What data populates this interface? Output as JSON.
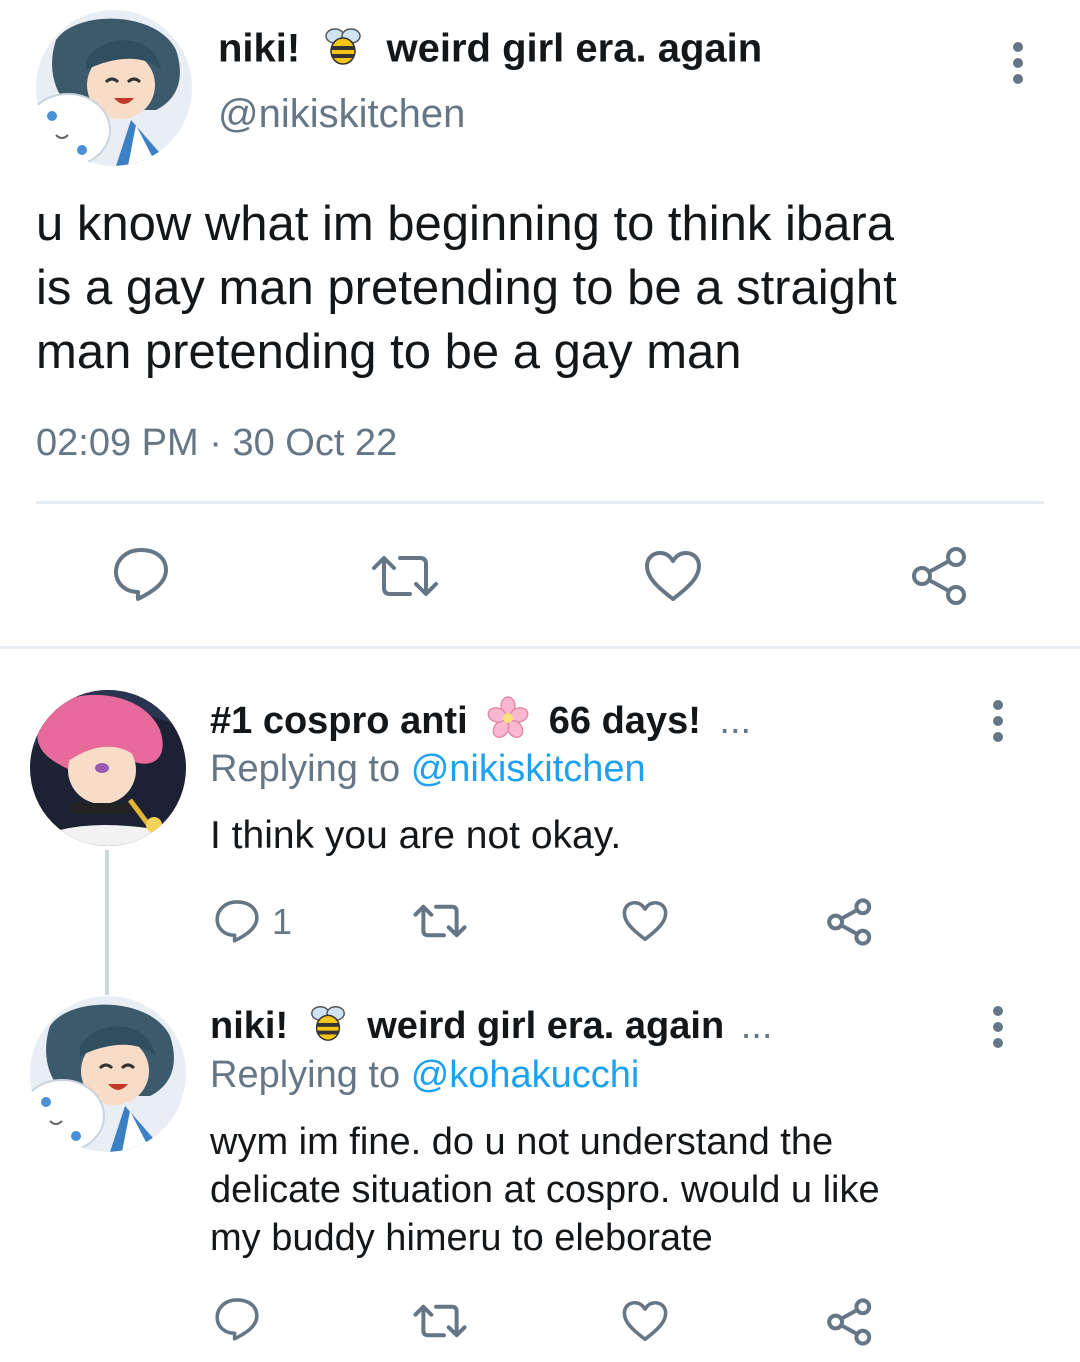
{
  "main_tweet": {
    "display_name": "niki!",
    "name_suffix": "weird girl era. again",
    "name_emoji": "bee-emoji",
    "handle": "@nikiskitchen",
    "text_lines": [
      "u know what im beginning to think ibara",
      "is a gay man pretending to be a straight",
      "man pretending to be a gay man"
    ],
    "time": "02:09 PM",
    "separator": "·",
    "date": "30 Oct 22"
  },
  "reply1": {
    "name_prefix": "#1 cospro anti",
    "name_emoji": "cherry-blossom-emoji",
    "name_suffix": "66 days!",
    "ellipsis": "...",
    "replying_label": "Replying to",
    "replying_handle": "@nikiskitchen",
    "text": "I think you are not okay.",
    "reply_count": "1"
  },
  "reply2": {
    "display_name": "niki!",
    "name_emoji": "bee-emoji",
    "name_suffix": "weird girl era. again",
    "ellipsis": "...",
    "replying_label": "Replying to",
    "replying_handle": "@kohakucchi",
    "text_lines": [
      "wym im fine. do u not understand the",
      "delicate situation at cospro. would u like",
      "my buddy himeru to eleborate"
    ]
  },
  "colors": {
    "text": "#14171a",
    "muted": "#657786",
    "link": "#1da1f2",
    "divider": "#e6ecf0"
  }
}
